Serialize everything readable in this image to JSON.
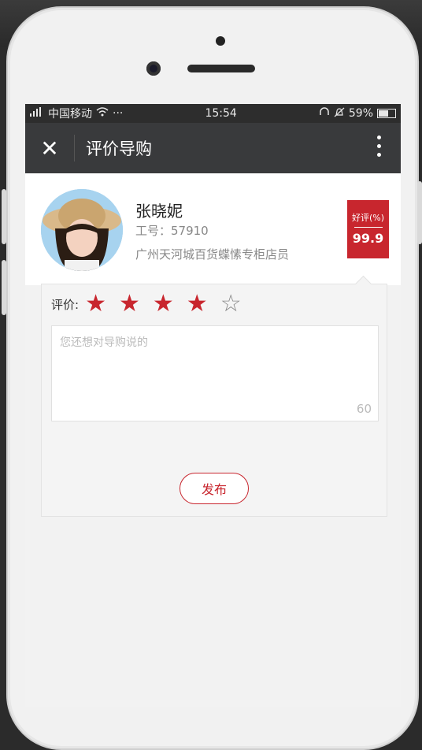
{
  "statusbar": {
    "carrier": "中国移动",
    "signal_icon": "signal-icon",
    "wifi_icon": "wifi-icon",
    "dots": "···",
    "time": "15:54",
    "battery": "59%",
    "battery_level": 0.59
  },
  "nav": {
    "title": "评价导购",
    "close_icon": "✕"
  },
  "profile": {
    "name": "张晓妮",
    "employee_id": "工号：57910",
    "role": "广州天河城百货蝶愫专柜店员",
    "badge_label": "好评(%)",
    "badge_value": "99.9"
  },
  "review": {
    "rating_label": "评价:",
    "rating": 4,
    "max_rating": 5,
    "placeholder": "您还想对导购说的",
    "char_limit": "60",
    "publish_label": "发布"
  },
  "colors": {
    "accent": "#c8262e",
    "navbar": "#393a3c"
  }
}
